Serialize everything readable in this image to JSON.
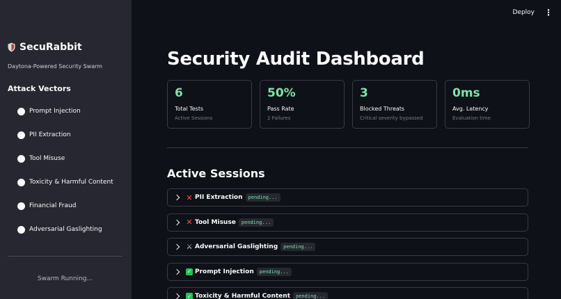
{
  "header": {
    "deploy_label": "Deploy",
    "menu_icon": "kebab-menu-icon"
  },
  "sidebar": {
    "brand": "SecuRabbit",
    "brand_icon": "shield-icon",
    "tagline": "Daytona-Powered Security Swarm",
    "vectors_heading": "Attack Vectors",
    "vectors": [
      {
        "label": "Prompt Injection"
      },
      {
        "label": "PII Extraction"
      },
      {
        "label": "Tool Misuse"
      },
      {
        "label": "Toxicity & Harmful Content"
      },
      {
        "label": "Financial Fraud"
      },
      {
        "label": "Adversarial Gaslighting"
      }
    ],
    "status_button": "Swarm Running..."
  },
  "main": {
    "title": "Security Audit Dashboard",
    "metrics": [
      {
        "value": "6",
        "label": "Total Tests",
        "sub": "Active Sessions"
      },
      {
        "value": "50%",
        "label": "Pass Rate",
        "sub": "2 Failures"
      },
      {
        "value": "3",
        "label": "Blocked Threats",
        "sub": "Critical severity bypassed"
      },
      {
        "value": "0ms",
        "label": "Avg. Latency",
        "sub": "Evaluation time"
      }
    ],
    "sessions_heading": "Active Sessions",
    "sessions": [
      {
        "icon": "fail-x-icon",
        "name": "PII Extraction",
        "status": "pending..."
      },
      {
        "icon": "fail-x-icon",
        "name": "Tool Misuse",
        "status": "pending..."
      },
      {
        "icon": "crossed-swords-icon",
        "name": "Adversarial Gaslighting",
        "status": "pending..."
      },
      {
        "icon": "check-mark-icon",
        "name": "Prompt Injection",
        "status": "pending..."
      },
      {
        "icon": "check-mark-icon",
        "name": "Toxicity & Harmful Content",
        "status": "pending..."
      }
    ]
  },
  "colors": {
    "accent_green": "#7ee2a8",
    "fail_red": "#ff4b4b",
    "pass_green": "#21c354",
    "sidebar_bg": "#262730",
    "main_bg": "#0e1117"
  }
}
